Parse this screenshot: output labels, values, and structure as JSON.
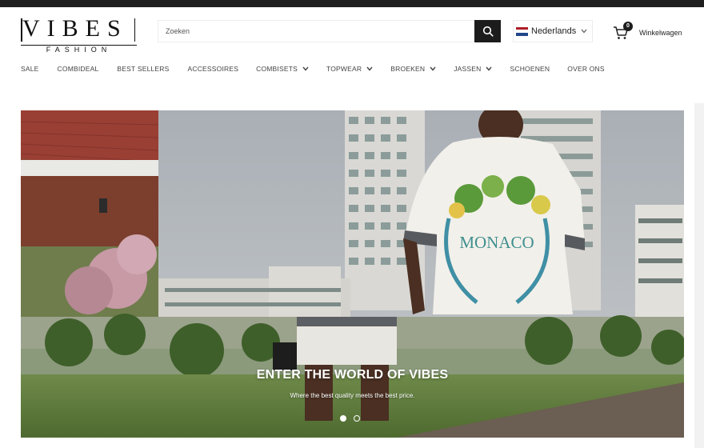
{
  "brand": {
    "logo_main": "VIBES",
    "logo_sub": "FASHION"
  },
  "search": {
    "placeholder": "Zoeken"
  },
  "language": {
    "selected": "Nederlands",
    "flag_colors": [
      "#ae1c28",
      "#ffffff",
      "#21468b"
    ]
  },
  "cart": {
    "count": "0",
    "label": "Winkelwagen"
  },
  "nav": {
    "items": [
      {
        "label": "SALE",
        "has_dropdown": false
      },
      {
        "label": "COMBIDEAL",
        "has_dropdown": false
      },
      {
        "label": "BEST SELLERS",
        "has_dropdown": false
      },
      {
        "label": "ACCESSOIRES",
        "has_dropdown": false
      },
      {
        "label": "COMBISETS",
        "has_dropdown": true
      },
      {
        "label": "TOPWEAR",
        "has_dropdown": true
      },
      {
        "label": "BROEKEN",
        "has_dropdown": true
      },
      {
        "label": "JASSEN",
        "has_dropdown": true
      },
      {
        "label": "SCHOENEN",
        "has_dropdown": false
      },
      {
        "label": "OVER ONS",
        "has_dropdown": false
      }
    ]
  },
  "hero": {
    "title": "ENTER THE WORLD OF VIBES",
    "subtitle": "Where the best quality meets the best price.",
    "shirt_text": "MONACO",
    "slides": 2,
    "active_slide": 1
  },
  "colors": {
    "dark": "#1c1c1c",
    "text": "#444444"
  }
}
